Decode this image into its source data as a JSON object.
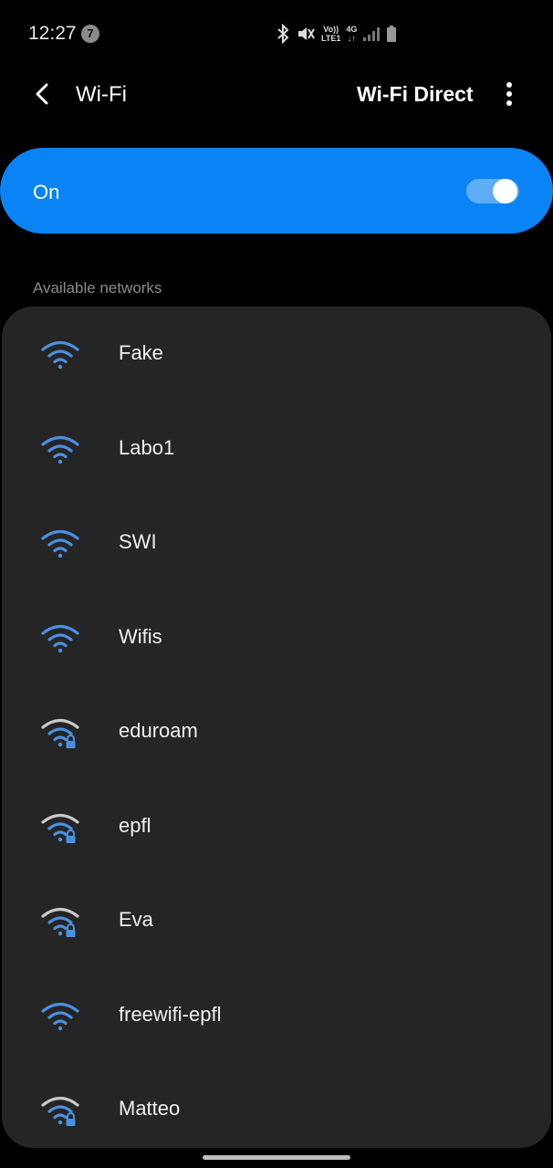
{
  "status_bar": {
    "time": "12:27",
    "notification_count": "7",
    "volte_top": "Vo))",
    "volte_bottom": "LTE1",
    "network_type": "4G"
  },
  "app_bar": {
    "title": "Wi-Fi",
    "wifi_direct_label": "Wi-Fi Direct"
  },
  "wifi_toggle": {
    "label": "On",
    "state": "on",
    "accent_color": "#0a83f5"
  },
  "available_networks": {
    "header": "Available networks",
    "items": [
      {
        "name": "Fake",
        "secured": false,
        "icon": "wifi-open-icon"
      },
      {
        "name": "Labo1",
        "secured": false,
        "icon": "wifi-open-icon"
      },
      {
        "name": "SWI",
        "secured": false,
        "icon": "wifi-open-icon"
      },
      {
        "name": "Wifis",
        "secured": false,
        "icon": "wifi-open-icon"
      },
      {
        "name": "eduroam",
        "secured": true,
        "icon": "wifi-lock-icon"
      },
      {
        "name": "epfl",
        "secured": true,
        "icon": "wifi-lock-icon"
      },
      {
        "name": "Eva",
        "secured": true,
        "icon": "wifi-lock-icon"
      },
      {
        "name": "freewifi-epfl",
        "secured": false,
        "icon": "wifi-open-icon"
      },
      {
        "name": "Matteo",
        "secured": true,
        "icon": "wifi-lock-icon"
      }
    ]
  }
}
